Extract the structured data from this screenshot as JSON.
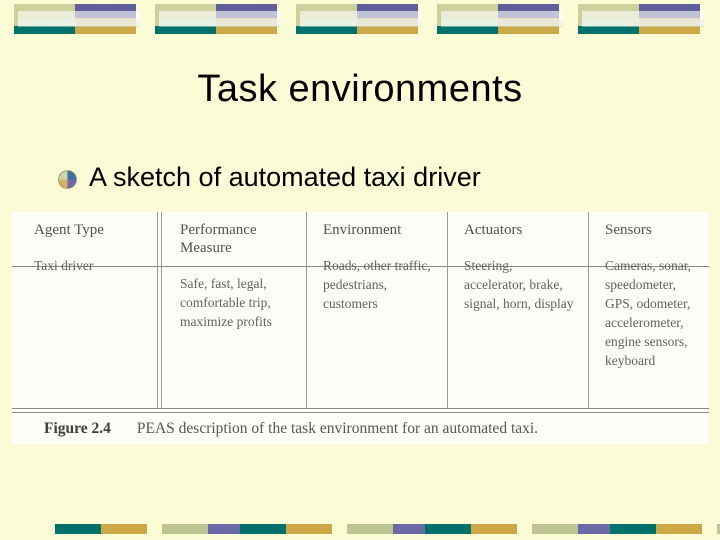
{
  "slide": {
    "title": "Task environments",
    "bullet": {
      "icon": "pie-bullet-icon",
      "text": "A sketch of automated taxi driver"
    },
    "background_color": "#fbfbd6"
  },
  "decor": {
    "top_band": {
      "repeat": 5,
      "colors": {
        "sage": "#ccd09b",
        "teal": "#00716b",
        "purple": "#5f5f9c",
        "gold": "#cda847"
      }
    },
    "bottom_band": {
      "repeat": 4,
      "segment_colors": [
        "#00716b",
        "#cda847",
        "#bcc492",
        "#6a6aa6"
      ]
    }
  },
  "figure": {
    "table": {
      "headers": [
        "Agent Type",
        "Performance Measure",
        "Environment",
        "Actuators",
        "Sensors"
      ],
      "rows": [
        [
          "Taxi driver",
          "Safe, fast, legal, comfortable trip, maximize profits",
          "Roads, other traffic, pedestrians, customers",
          "Steering, accelerator, brake, signal, horn, display",
          "Cameras, sonar, speedometer, GPS, odometer, accelerometer, engine sensors, keyboard"
        ]
      ]
    },
    "caption_label": "Figure 2.4",
    "caption_text": "PEAS description of the task environment for an automated taxi."
  }
}
